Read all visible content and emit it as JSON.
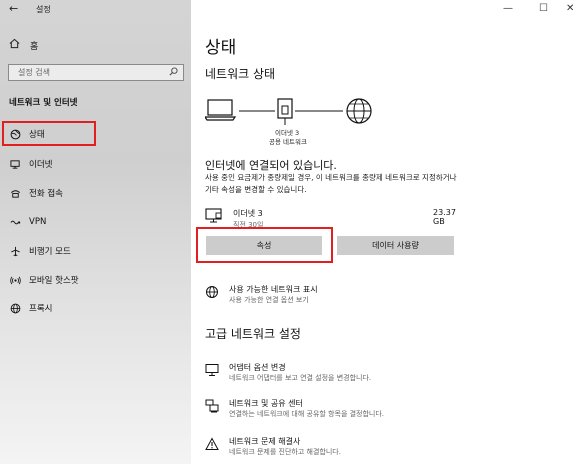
{
  "window": {
    "title": "설정",
    "back_glyph": "←",
    "minimize_glyph": "—",
    "maximize_glyph": "☐",
    "close_glyph": "✕"
  },
  "sidebar": {
    "home_label": "홈",
    "search_placeholder": "설정 검색",
    "section_title": "네트워크 및 인터넷",
    "items": [
      {
        "label": "상태",
        "icon": "globe-status-icon",
        "selected": true
      },
      {
        "label": "이더넷",
        "icon": "ethernet-icon"
      },
      {
        "label": "전화 접속",
        "icon": "dialup-icon"
      },
      {
        "label": "VPN",
        "icon": "vpn-icon"
      },
      {
        "label": "비행기 모드",
        "icon": "airplane-icon"
      },
      {
        "label": "모바일 핫스팟",
        "icon": "hotspot-icon"
      },
      {
        "label": "프록시",
        "icon": "proxy-globe-icon"
      }
    ]
  },
  "main": {
    "title": "상태",
    "network_status_title": "네트워크 상태",
    "diagram": {
      "adapter_name": "이더넷 3",
      "network_type": "공용 네트워크"
    },
    "connected_text": "인터넷에 연결되어 있습니다.",
    "description": "사용 중인 요금제가 종량제일 경우, 이 네트워크를 종량제 네트워크로 지정하거나 기타 속성을 변경할 수 있습니다.",
    "connection": {
      "name": "이더넷 3",
      "sub": "직전 30일",
      "usage": "23.37 GB"
    },
    "buttons": {
      "properties": "속성",
      "data_usage": "데이터 사용량"
    },
    "show_networks": {
      "title": "사용 가능한 네트워크 표시",
      "sub": "사용 가능한 연결 옵션 보기"
    },
    "advanced_title": "고급 네트워크 설정",
    "advanced_items": [
      {
        "title": "어댑터 옵션 변경",
        "sub": "네트워크 어댑터를 보고 연결 설정을 변경합니다."
      },
      {
        "title": "네트워크 및 공유 센터",
        "sub": "연결하는 네트워크에 대해 공유할 항목을 결정합니다."
      },
      {
        "title": "네트워크 문제 해결사",
        "sub": "네트워크 문제를 진단하고 해결합니다."
      }
    ]
  },
  "colors": {
    "highlight": "#e02020",
    "button_bg": "#cccccc"
  }
}
